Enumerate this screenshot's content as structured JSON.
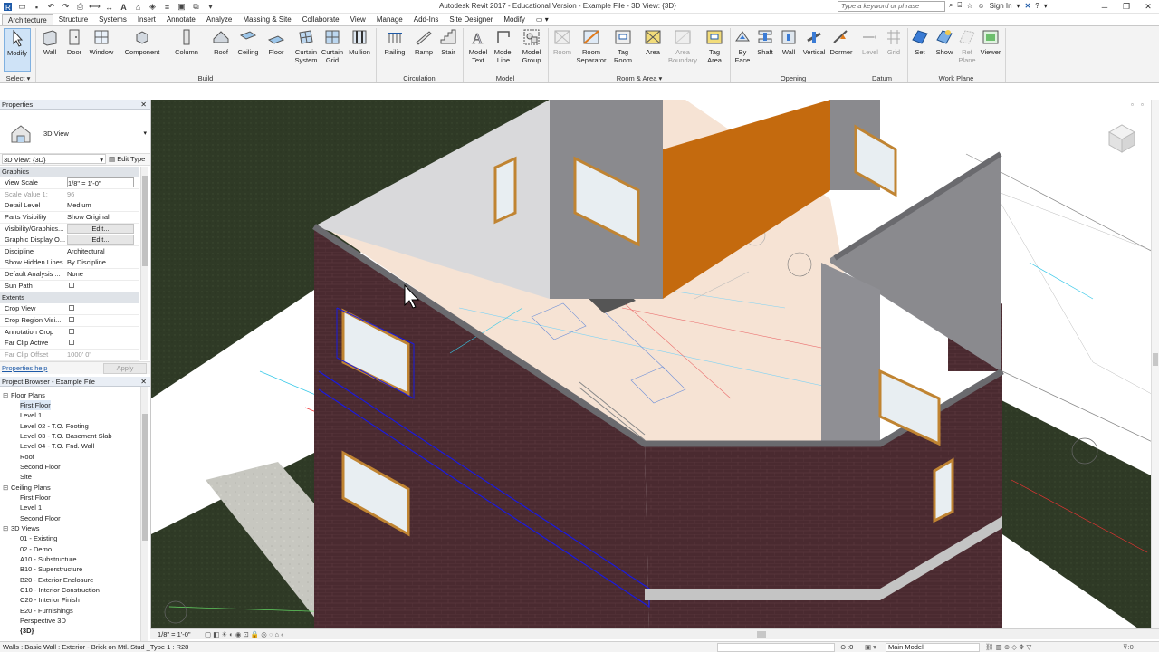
{
  "titlebar": {
    "title": "Autodesk Revit 2017 - Educational Version -      Example File - 3D View: {3D}",
    "search_placeholder": "Type a keyword or phrase",
    "sign_in": "Sign In"
  },
  "tabs": [
    "Architecture",
    "Structure",
    "Systems",
    "Insert",
    "Annotate",
    "Analyze",
    "Massing & Site",
    "Collaborate",
    "View",
    "Manage",
    "Add-Ins",
    "Site Designer",
    "Modify"
  ],
  "ribbon": {
    "modify": "Modify",
    "select": "Select",
    "build": {
      "label": "Build",
      "buttons": [
        "Wall",
        "Door",
        "Window",
        "Component",
        "Column",
        "Roof",
        "Ceiling",
        "Floor",
        "Curtain System",
        "Curtain Grid",
        "Mullion"
      ]
    },
    "circulation": {
      "label": "Circulation",
      "buttons": [
        "Railing",
        "Ramp",
        "Stair"
      ]
    },
    "model": {
      "label": "Model",
      "buttons": [
        "Model Text",
        "Model Line",
        "Model Group"
      ]
    },
    "room_area": {
      "label": "Room & Area",
      "buttons": [
        "Room",
        "Room Separator",
        "Tag Room",
        "Area",
        "Area Boundary",
        "Tag Area"
      ]
    },
    "opening": {
      "label": "Opening",
      "buttons": [
        "By Face",
        "Shaft",
        "Wall",
        "Vertical",
        "Dormer"
      ]
    },
    "datum": {
      "label": "Datum",
      "buttons": [
        "Level",
        "Grid"
      ]
    },
    "work_plane": {
      "label": "Work Plane",
      "buttons": [
        "Set",
        "Show",
        "Ref Plane",
        "Viewer"
      ]
    }
  },
  "properties": {
    "title": "Properties",
    "type_name": "3D View",
    "combo": "3D View: {3D}",
    "edit_type": "Edit Type",
    "group_graphics": "Graphics",
    "group_extents": "Extents",
    "rows": [
      {
        "k": "View Scale",
        "v": "1/8\" = 1'-0\""
      },
      {
        "k": "Scale Value    1:",
        "v": "96"
      },
      {
        "k": "Detail Level",
        "v": "Medium"
      },
      {
        "k": "Parts Visibility",
        "v": "Show Original"
      },
      {
        "k": "Visibility/Graphics...",
        "v": "Edit..."
      },
      {
        "k": "Graphic Display O...",
        "v": "Edit..."
      },
      {
        "k": "Discipline",
        "v": "Architectural"
      },
      {
        "k": "Show Hidden Lines",
        "v": "By Discipline"
      },
      {
        "k": "Default Analysis ...",
        "v": "None"
      },
      {
        "k": "Sun Path",
        "v": ""
      }
    ],
    "extent_rows": [
      {
        "k": "Crop View",
        "v": ""
      },
      {
        "k": "Crop Region Visi...",
        "v": ""
      },
      {
        "k": "Annotation Crop",
        "v": ""
      },
      {
        "k": "Far Clip Active",
        "v": ""
      },
      {
        "k": "Far Clip Offset",
        "v": "1000'  0\""
      }
    ],
    "help": "Properties help",
    "apply": "Apply"
  },
  "browser": {
    "title": "Project Browser - Example File",
    "floor_plans": "Floor Plans",
    "floor_items": [
      "First Floor",
      "Level 1",
      "Level 02 - T.O. Footing",
      "Level 03 - T.O. Basement Slab",
      "Level 04 - T.O. Fnd. Wall",
      "Roof",
      "Second Floor",
      "Site"
    ],
    "ceiling_plans": "Ceiling Plans",
    "ceiling_items": [
      "First Floor",
      "Level 1",
      "Second Floor"
    ],
    "views_3d": "3D Views",
    "view_items": [
      "01 - Existing",
      "02 - Demo",
      "A10 - Substructure",
      "B10 - Superstructure",
      "B20 - Exterior Enclosure",
      "C10 - Interior Construction",
      "C20 - Interior Finish",
      "E20 - Furnishings",
      "Perspective 3D",
      "{3D}"
    ]
  },
  "viewbar": {
    "scale": "1/8\" = 1'-0\""
  },
  "statusbar": {
    "text": "Walls : Basic Wall : Exterior - Brick on Mtl. Stud _Type 1 : R28",
    "zero": ":0",
    "model": "Main Model"
  },
  "colors": {
    "brick": "#4a2a30",
    "grass": "#2f3a26",
    "accent_wall": "#c46a0e",
    "floor": "#f6e3d4",
    "ribbon_bg": "#f3f3f3"
  }
}
